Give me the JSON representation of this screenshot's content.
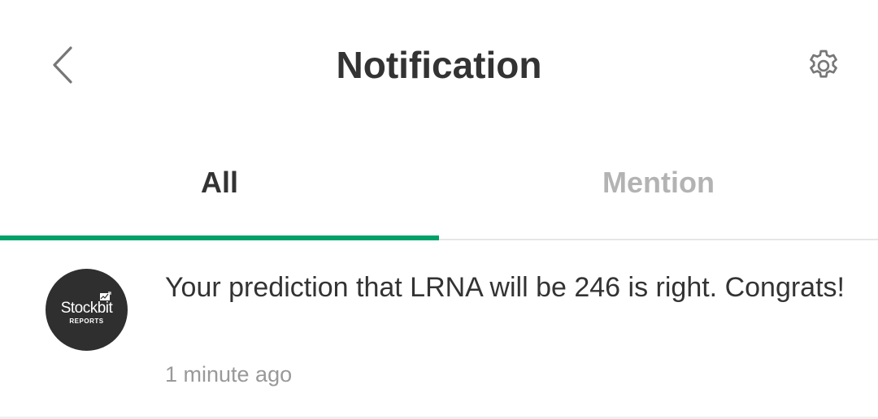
{
  "header": {
    "title": "Notification",
    "back_icon": "chevron-left-icon",
    "settings_icon": "gear-icon"
  },
  "tabs": [
    {
      "label": "All",
      "active": true
    },
    {
      "label": "Mention",
      "active": false
    }
  ],
  "notifications": [
    {
      "avatar": {
        "brand": "Stockbit",
        "subtitle": "REPORTS"
      },
      "message": "Your prediction that LRNA will be 246 is right. Congrats!",
      "time": "1 minute ago"
    }
  ],
  "colors": {
    "accent": "#00a06a",
    "title_text": "#333333",
    "inactive_tab": "#b3b3b3",
    "muted_text": "#999999",
    "avatar_bg": "#2f2f2f"
  }
}
